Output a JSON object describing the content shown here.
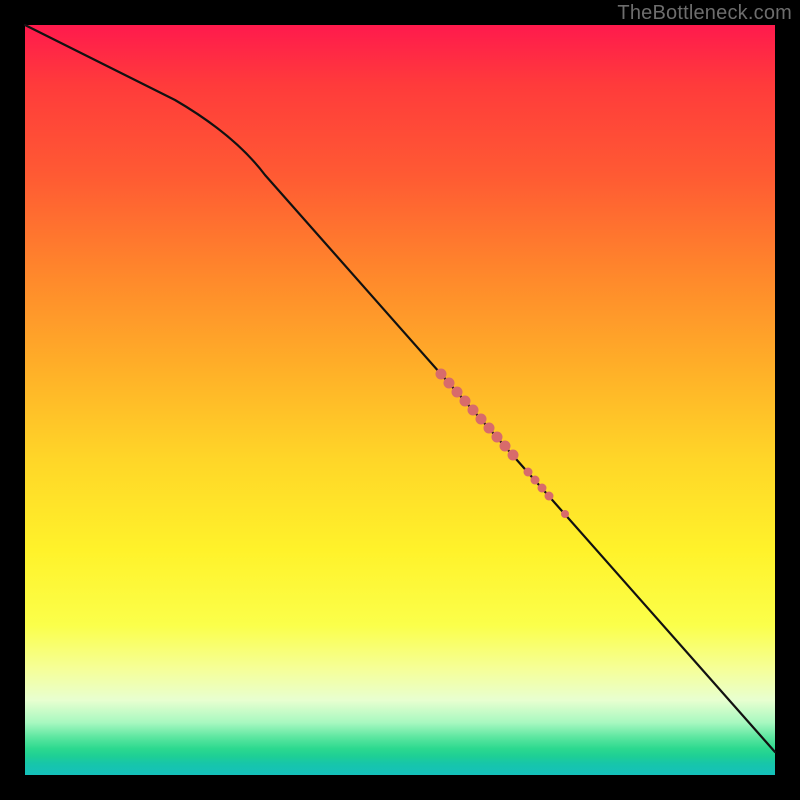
{
  "attribution": "TheBottleneck.com",
  "colors": {
    "frame": "#000000",
    "curve": "#111111",
    "marker": "#d86b6b",
    "gradient_stops": [
      "#ff1a4d",
      "#ff3b3b",
      "#ff5a33",
      "#ff8a2b",
      "#ffb028",
      "#ffd628",
      "#fff22a",
      "#fbff4a",
      "#f5ff9a",
      "#e8ffd0",
      "#a8f8c0",
      "#5be6a0",
      "#2cd98f",
      "#1ecf95",
      "#17c6aa",
      "#14c0bb"
    ]
  },
  "chart_data": {
    "type": "line",
    "title": "",
    "xlabel": "",
    "ylabel": "",
    "xlim": [
      0,
      100
    ],
    "ylim": [
      0,
      100
    ],
    "grid": false,
    "curve_points": [
      {
        "x": 0,
        "y": 100
      },
      {
        "x": 25,
        "y": 85.5
      },
      {
        "x": 32,
        "y": 80
      },
      {
        "x": 100,
        "y": 3
      }
    ],
    "highlight_segments": [
      {
        "x_start": 55.5,
        "x_end": 65.5,
        "radius": 5.5
      },
      {
        "x_start": 67.0,
        "x_end": 70.0,
        "radius": 4.5
      },
      {
        "x_start": 71.8,
        "x_end": 72.8,
        "radius": 4.0
      }
    ]
  }
}
